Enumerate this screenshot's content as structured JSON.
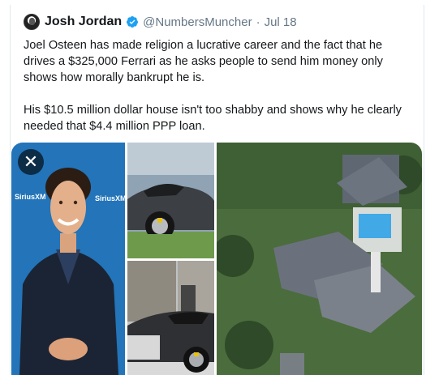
{
  "tweet": {
    "author_name": "Josh Jordan",
    "handle": "@NumbersMuncher",
    "separator": "·",
    "date": "Jul 18",
    "paragraphs": [
      "Joel Osteen has made religion a lucrative career and the fact that he drives a $325,000 Ferrari as he asks people to send him money only shows how morally bankrupt he is.",
      "His $10.5 million dollar house isn't too shabby and shows why he clearly needed that $4.4 million PPP loan."
    ]
  },
  "media": {
    "close_label": "✕",
    "backdrop_logo": "SiriusXM",
    "icons": [
      "close-icon",
      "verified-badge-icon"
    ],
    "colors": {
      "accent": "#1da1f2",
      "backdrop_blue": "#1f6fb3",
      "ferrari_gray": "#3c3f43",
      "lawn_green": "#6e9a4b",
      "pool_blue": "#41a9e6"
    }
  }
}
